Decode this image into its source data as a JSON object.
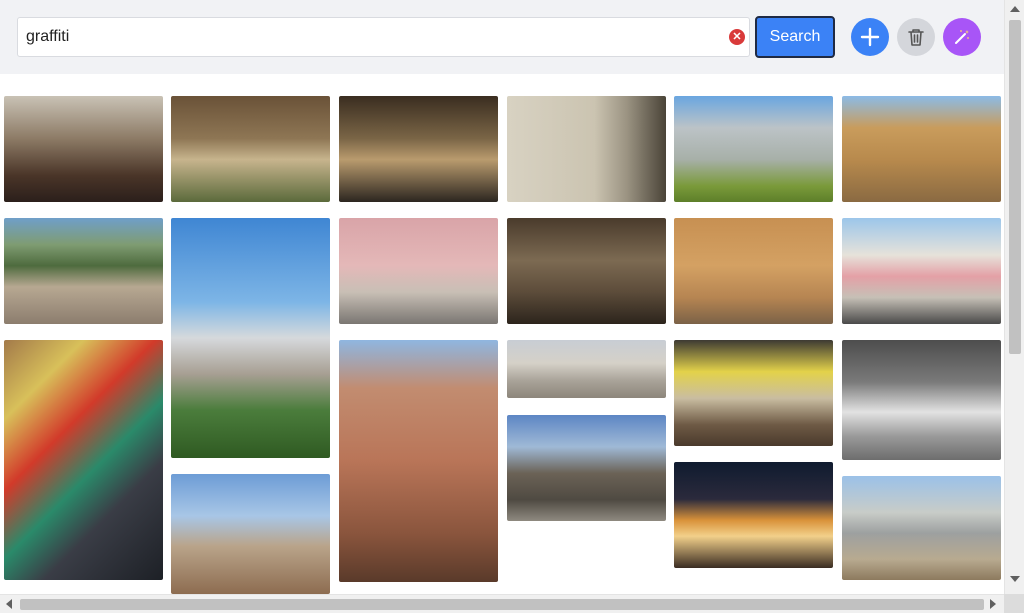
{
  "search": {
    "value": "graffiti",
    "button_label": "Search"
  },
  "icons": {
    "clear": "close-circle-icon",
    "add": "plus-icon",
    "trash": "trash-icon",
    "magic": "magic-wand-icon"
  },
  "colors": {
    "accent": "#3b82f6",
    "magic": "#a855f7",
    "clear": "#d93a3a",
    "neutral_button": "#d4d6db"
  },
  "gallery": {
    "items": [
      {
        "name": "street-crowd"
      },
      {
        "name": "balcony-building"
      },
      {
        "name": "dark-alley"
      },
      {
        "name": "statue-marble"
      },
      {
        "name": "cemetery-wall"
      },
      {
        "name": "old-facade"
      },
      {
        "name": "city-aerial"
      },
      {
        "name": "coastal-city-view"
      },
      {
        "name": "pink-street"
      },
      {
        "name": "stone-alley"
      },
      {
        "name": "orange-building"
      },
      {
        "name": "festive-street"
      },
      {
        "name": "graffiti-garage"
      },
      {
        "name": "red-medina-alley"
      },
      {
        "name": "dense-city"
      },
      {
        "name": "yellow-kiosk"
      },
      {
        "name": "vintage-car"
      },
      {
        "name": "ruined-arch"
      },
      {
        "name": "cat-on-wall"
      },
      {
        "name": "night-fountain"
      },
      {
        "name": "abandoned-houses"
      }
    ]
  }
}
